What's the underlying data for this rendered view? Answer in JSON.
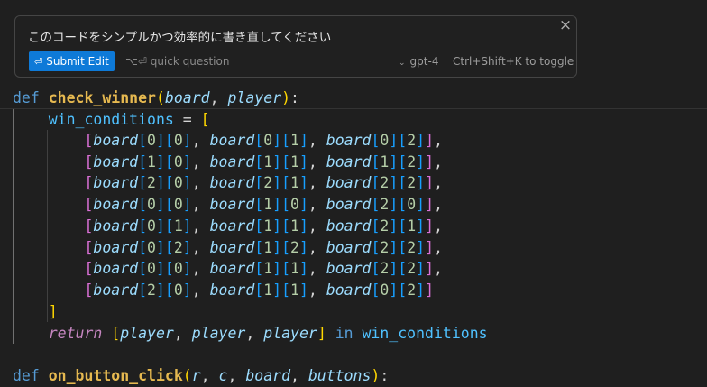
{
  "prompt": {
    "text": "このコードをシンプルかつ効率的に書き直してください",
    "submit_icon": "⏎",
    "submit_label": "Submit Edit",
    "quick_question": "⌥⏎ quick question",
    "model_chevron": "⌄",
    "model": "gpt-4",
    "toggle_hint": "Ctrl+Shift+K to toggle",
    "close_icon": "×"
  },
  "code": {
    "func_name": "check_winner",
    "param_board": "board",
    "param_player": "player",
    "win_var": "win_conditions",
    "board_name": "board",
    "rows": [
      [
        [
          0,
          0
        ],
        [
          0,
          1
        ],
        [
          0,
          2
        ]
      ],
      [
        [
          1,
          0
        ],
        [
          1,
          1
        ],
        [
          1,
          2
        ]
      ],
      [
        [
          2,
          0
        ],
        [
          2,
          1
        ],
        [
          2,
          2
        ]
      ],
      [
        [
          0,
          0
        ],
        [
          1,
          0
        ],
        [
          2,
          0
        ]
      ],
      [
        [
          0,
          1
        ],
        [
          1,
          1
        ],
        [
          2,
          1
        ]
      ],
      [
        [
          0,
          2
        ],
        [
          1,
          2
        ],
        [
          2,
          2
        ]
      ],
      [
        [
          0,
          0
        ],
        [
          1,
          1
        ],
        [
          2,
          2
        ]
      ],
      [
        [
          2,
          0
        ],
        [
          1,
          1
        ],
        [
          0,
          2
        ]
      ]
    ],
    "return_kw": "return",
    "player_name": "player",
    "in_kw": "in",
    "next_func_name": "on_button_click",
    "next_params": [
      "r",
      "c",
      "board",
      "buttons"
    ]
  },
  "colors": {
    "keyword": "#569cd6",
    "function": "#dcdcaa",
    "parameter": "#9cdcfe",
    "variable": "#4fc1ff",
    "number": "#b5cea8",
    "control": "#c586c0",
    "bracket1": "#ffd700",
    "bracket2": "#da70d6",
    "bracket3": "#179fff",
    "button": "#0e7ad8"
  }
}
